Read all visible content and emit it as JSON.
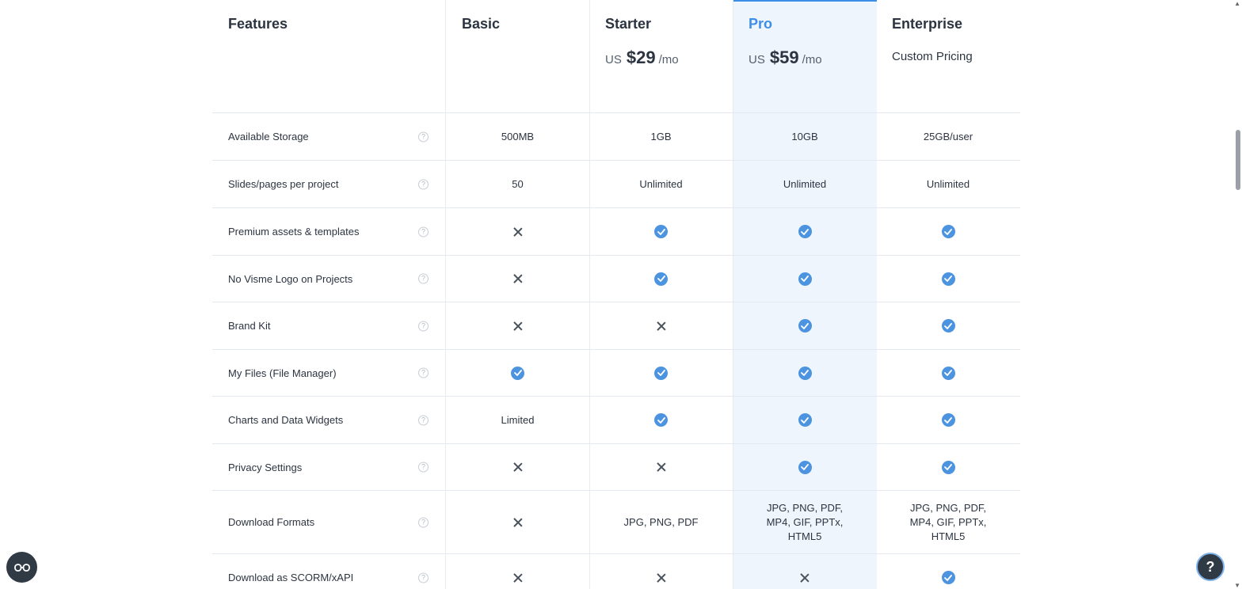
{
  "header": {
    "features_label": "Features",
    "plans": [
      {
        "name": "Basic"
      },
      {
        "name": "Starter",
        "currency": "US",
        "amount": "$29",
        "period": "/mo"
      },
      {
        "name": "Pro",
        "currency": "US",
        "amount": "$59",
        "period": "/mo"
      },
      {
        "name": "Enterprise",
        "custom": "Custom Pricing"
      }
    ]
  },
  "rows": [
    {
      "feature": "Available Storage",
      "values": [
        "500MB",
        "1GB",
        "10GB",
        "25GB/user"
      ]
    },
    {
      "feature": "Slides/pages per project",
      "values": [
        "50",
        "Unlimited",
        "Unlimited",
        "Unlimited"
      ]
    },
    {
      "feature": "Premium assets & templates",
      "values": [
        "cross",
        "check",
        "check",
        "check"
      ]
    },
    {
      "feature": "No Visme Logo on Projects",
      "values": [
        "cross",
        "check",
        "check",
        "check"
      ]
    },
    {
      "feature": "Brand Kit",
      "values": [
        "cross",
        "cross",
        "check",
        "check"
      ]
    },
    {
      "feature": "My Files (File Manager)",
      "values": [
        "check",
        "check",
        "check",
        "check"
      ]
    },
    {
      "feature": "Charts and Data Widgets",
      "values": [
        "Limited",
        "check",
        "check",
        "check"
      ]
    },
    {
      "feature": "Privacy Settings",
      "values": [
        "cross",
        "cross",
        "check",
        "check"
      ]
    },
    {
      "feature": "Download Formats",
      "values": [
        "cross",
        "JPG, PNG, PDF",
        "JPG, PNG, PDF, MP4, GIF, PPTx, HTML5",
        "JPG, PNG, PDF, MP4, GIF, PPTx, HTML5"
      ]
    },
    {
      "feature": "Download as SCORM/xAPI",
      "values": [
        "cross",
        "cross",
        "cross",
        "check"
      ]
    }
  ],
  "help_button": {
    "label": "?"
  },
  "icons": {
    "info": "question-circle-icon",
    "check": "check-circle-icon",
    "cross": "cross-icon",
    "accessibility": "glasses-icon"
  },
  "colors": {
    "accent": "#3d8ee6",
    "highlight_bg": "#eef5fd",
    "check": "#4d94e0"
  }
}
